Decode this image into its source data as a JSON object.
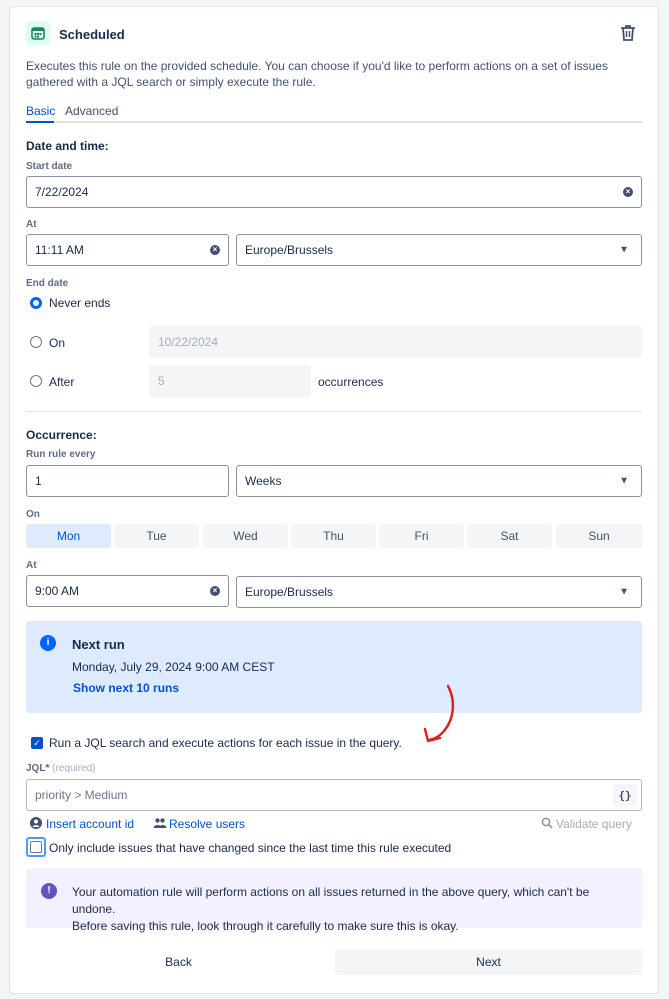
{
  "header": {
    "title": "Scheduled"
  },
  "description": "Executes this rule on the provided schedule. You can choose if you'd like to perform actions on a set of issues gathered with a JQL search or simply execute the rule.",
  "tabs": [
    {
      "label": "Basic"
    },
    {
      "label": "Advanced"
    }
  ],
  "date_time": {
    "section_title": "Date and time:",
    "start_date_label": "Start date",
    "start_date_value": "7/22/2024",
    "at_label": "At",
    "time_value": "11:11 AM",
    "timezone_value": "Europe/Brussels"
  },
  "end_date": {
    "label": "End date",
    "never_ends_label": "Never ends",
    "on_label": "On",
    "on_date_value": "10/22/2024",
    "after_label": "After",
    "after_count_value": "5",
    "occurrences_label": "occurrences"
  },
  "occurrence": {
    "section_title": "Occurrence:",
    "run_every_label": "Run rule every",
    "run_every_value": "1",
    "unit_value": "Weeks",
    "on_label": "On",
    "days": [
      "Mon",
      "Tue",
      "Wed",
      "Thu",
      "Fri",
      "Sat",
      "Sun"
    ],
    "at_label": "At",
    "time_value": "9:00 AM",
    "timezone_value": "Europe/Brussels"
  },
  "next_run": {
    "title": "Next run",
    "datetime": "Monday, July 29, 2024 9:00 AM CEST",
    "show_more_link": "Show next 10 runs"
  },
  "jql": {
    "checkbox_label": "Run a JQL search and execute actions for each issue in the query.",
    "label": "JQL",
    "required_marker": "*",
    "required_text": "(required)",
    "value": "priority > Medium",
    "brace_button": "{}",
    "insert_account_link": "Insert account id",
    "resolve_users_link": "Resolve users",
    "validate_link": "Validate query",
    "only_changed_label": "Only include issues that have changed since the last time this rule executed"
  },
  "warning": {
    "line1": "Your automation rule will perform actions on all issues returned in the above query, which can't be undone.",
    "line2": "Before saving this rule, look through it carefully to make sure this is okay."
  },
  "buttons": {
    "back": "Back",
    "next": "Next"
  },
  "colors": {
    "accent": "#0052cc",
    "info_bg": "#deebff",
    "warn_bg": "#f3f0ff",
    "annotation": "#e01e1e"
  }
}
